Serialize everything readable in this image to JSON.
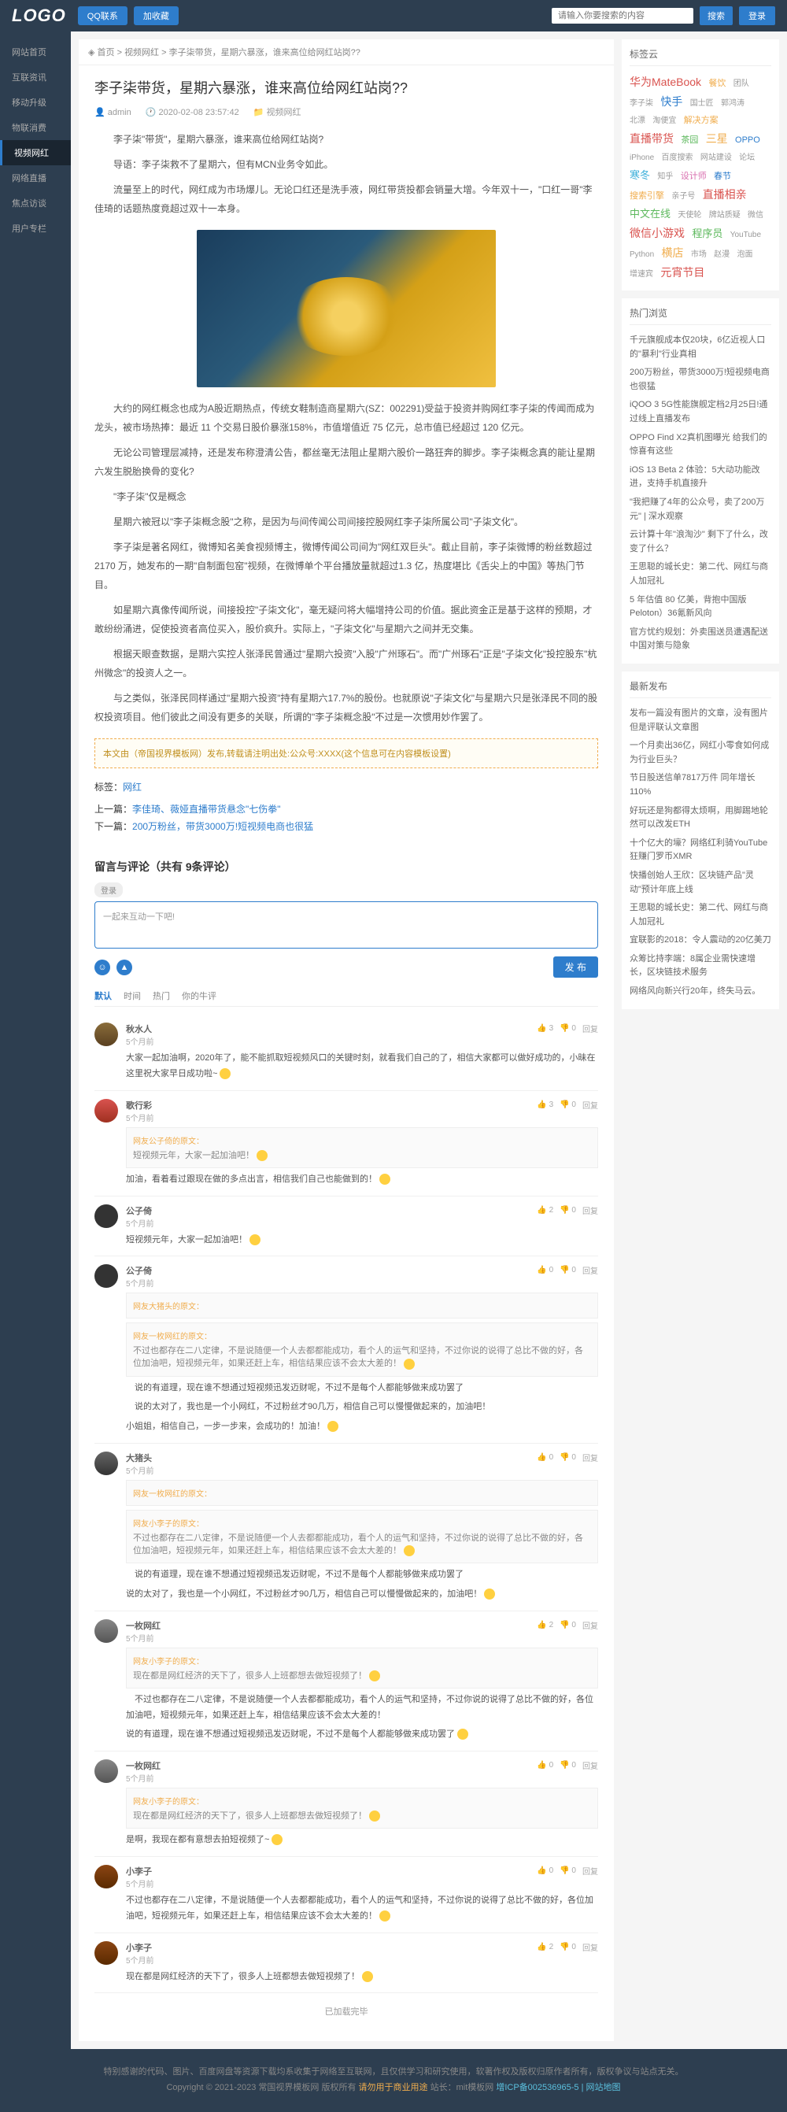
{
  "topbar": {
    "logo": "LOGO",
    "qq": "QQ联系",
    "fav": "加收藏",
    "search_placeholder": "请输入你要搜索的内容",
    "search_btn": "搜索",
    "login": "登录"
  },
  "nav": [
    {
      "label": "网站首页"
    },
    {
      "label": "互联资讯"
    },
    {
      "label": "移动升级"
    },
    {
      "label": "物联消费"
    },
    {
      "label": "视频网红",
      "active": true
    },
    {
      "label": "网络直播"
    },
    {
      "label": "焦点访谈"
    },
    {
      "label": "用户专栏"
    }
  ],
  "breadcrumb": {
    "home": "首页",
    "cat": "视频网红",
    "title": "李子柒带货，星期六暴涨，谁来高位给网红站岗??"
  },
  "article": {
    "title": "李子柒带货，星期六暴涨，谁来高位给网红站岗??",
    "author": "admin",
    "date": "2020-02-08 23:57:42",
    "cat": "视频网红",
    "p1": "李子柒\"带货\"，星期六暴涨，谁来高位给网红站岗?",
    "p2": "导语：李子柒救不了星期六，但有MCN业务令如此。",
    "p3": "流量至上的时代，网红成为市场爆儿。无论口红还是洗手液，网红带货投都会销量大增。今年双十一，\"口红一哥\"李佳琦的话题热度竟超过双十一本身。",
    "p4": "大约的网红概念也成为A股近期热点，传统女鞋制造商星期六(SZ：002291)受益于投资并购网红李子柒的传闻而成为龙头，被市场热捧：最近 11 个交易日股价暴涨158%，市值增值近 75 亿元，总市值已经超过 120 亿元。",
    "p5": "无论公司管理层减持，还是发布称澄清公告，都丝毫无法阻止星期六股价一路狂奔的脚步。李子柒概念真的能让星期六发生脱胎换骨的变化?",
    "p6": "\"李子柒\"仅是概念",
    "p7": "星期六被冠以\"李子柒概念股\"之称，是因为与间传闻公司间接控股网红李子柒所属公司\"子柒文化\"。",
    "p8": "李子柒是著名网红，微博知名美食视频博主，微博传闻公司间为\"网红双巨头\"。截止目前，李子柒微博的粉丝数超过 2170 万，她发布的一期\"自制面包窑\"视频，在微博单个平台播放量就超过1.3 亿，热度堪比《舌尖上的中国》等热门节目。",
    "p9": "如星期六真像传闻所说，间接投控\"子柒文化\"，毫无疑问将大幅增持公司的价值。据此资金正是基于这样的预期，才敢纷纷涌进，促使投资者高位买入，股价疯升。实际上，\"子柒文化\"与星期六之间并无交集。",
    "p10": "根据天眼查数据，是期六实控人张泽民曾通过\"星期六投资\"入股\"广州琢石\"。而\"广州琢石\"正是\"子柒文化\"投控股东\"杭州微念\"的投资人之一。",
    "p11": "与之类似，张泽民同样通过\"星期六投资\"持有星期六17.7%的股份。也就原说\"子柒文化\"与星期六只是张泽民不同的股权投资项目。他们彼此之间没有更多的关联，所谓的\"李子柒概念股\"不过是一次惯用妙作罢了。",
    "notice": "本文由（帝国视界模板网）发布,转载请注明出处:公众号:XXXX(这个信息可在内容模板设置)",
    "tags_label": "标签：",
    "tag_link": "网红",
    "prev_label": "上一篇：",
    "prev_link": "李佳琦、薇娅直播带货悬念\"七伤拳\"",
    "next_label": "下一篇：",
    "next_link": "200万粉丝，带货3000万!短视频电商也很猛"
  },
  "comments": {
    "title": "留言与评论（共有 9条评论）",
    "login_hint": "登录",
    "placeholder": "一起来互动一下吧!",
    "publish": "发 布",
    "tabs": [
      "默认",
      "时间",
      "热门",
      "你的牛评"
    ],
    "load_done": "已加载完毕",
    "list": [
      {
        "avatar": "c1",
        "user": "秋水人",
        "time": "5个月前",
        "like": "3",
        "dis": "0",
        "reply": "回复",
        "text": "大家一起加油啊，2020年了，能不能抓取短视频风口的关键时刻，就看我们自己的了，相信大家都可以做好成功的，小昧在这里祝大家早日成功啦~"
      },
      {
        "avatar": "c2",
        "user": "歌行彩",
        "time": "5个月前",
        "like": "3",
        "dis": "0",
        "reply": "回复",
        "quotes": [
          {
            "u": "公子倚",
            "t": "短视频元年，大家一起加油吧！"
          }
        ],
        "text": "加油，看着看过跟现在做的多点出言，相信我们自己也能做到的！"
      },
      {
        "avatar": "c3",
        "user": "公子倚",
        "time": "5个月前",
        "like": "2",
        "dis": "0",
        "reply": "回复",
        "text": "短视频元年，大家一起加油吧！"
      },
      {
        "avatar": "c3",
        "user": "公子倚",
        "time": "5个月前",
        "like": "0",
        "dis": "0",
        "reply": "回复",
        "quotes": [
          {
            "u": "大猪头",
            "t": ""
          },
          {
            "u": "一枚网红",
            "t": "不过也都存在二八定律，不是说随便一个人去都都能成功，看个人的运气和坚持，不过你说的说得了总比不做的好，各位加油吧，短视频元年，如果还赶上车，相信结果应该不会太大差的！"
          }
        ],
        "text2": "说的有道理，现在谁不想通过短视频迅发迈财呢，不过不是每个人都能够做来成功罢了",
        "text3": "说的太对了，我也是一个小网红，不过粉丝才90几万，相信自己可以慢慢做起来的，加油吧！",
        "text": "小姐姐，相信自己，一步一步来，会成功的！加油！"
      },
      {
        "avatar": "c4",
        "user": "大猪头",
        "time": "5个月前",
        "like": "0",
        "dis": "0",
        "reply": "回复",
        "quotes": [
          {
            "u": "一枚网红",
            "t": ""
          },
          {
            "u": "小李子",
            "t": "不过也都存在二八定律，不是说随便一个人去都都能成功，看个人的运气和坚持，不过你说的说得了总比不做的好，各位加油吧，短视频元年，如果还赶上车，相信结果应该不会太大差的！"
          }
        ],
        "text2": "说的有道理，现在谁不想通过短视频迅发迈财呢，不过不是每个人都能够做来成功罢了",
        "text": "说的太对了，我也是一个小网红，不过粉丝才90几万，相信自己可以慢慢做起来的，加油吧！"
      },
      {
        "avatar": "c5",
        "user": "一枚网红",
        "time": "5个月前",
        "like": "2",
        "dis": "0",
        "reply": "回复",
        "quotes": [
          {
            "u": "小李子",
            "t": "现在都是网红经济的天下了，很多人上班都想去做短视频了！"
          }
        ],
        "text2": "不过也都存在二八定律，不是说随便一个人去都都能成功，看个人的运气和坚持，不过你说的说得了总比不做的好，各位加油吧，短视频元年，如果还赶上车，相信结果应该不会太大差的！",
        "text": "说的有道理，现在谁不想通过短视频迅发迈财呢，不过不是每个人都能够做来成功罢了"
      },
      {
        "avatar": "c5",
        "user": "一枚网红",
        "time": "5个月前",
        "like": "0",
        "dis": "0",
        "reply": "回复",
        "quotes": [
          {
            "u": "小李子",
            "t": "现在都是网红经济的天下了，很多人上班都想去做短视频了！"
          }
        ],
        "text": "是啊，我现在都有意想去拍短视频了~"
      },
      {
        "avatar": "c6",
        "user": "小李子",
        "time": "5个月前",
        "like": "0",
        "dis": "0",
        "reply": "回复",
        "text": "不过也都存在二八定律，不是说随便一个人去都都能成功，看个人的运气和坚持，不过你说的说得了总比不做的好，各位加油吧，短视频元年，如果还赶上车，相信结果应该不会太大差的！"
      },
      {
        "avatar": "c6",
        "user": "小李子",
        "time": "5个月前",
        "like": "2",
        "dis": "0",
        "reply": "回复",
        "text": "现在都是网红经济的天下了，很多人上班都想去做短视频了！"
      }
    ]
  },
  "side": {
    "tagcloud_title": "标签云",
    "hot_title": "热门浏览",
    "hot": [
      "千元旗舰成本仅20块，6亿近视人口的\"暴利\"行业真相",
      "200万粉丝，带货3000万!短视频电商也很猛",
      "iQOO 3 5G性能旗舰定档2月25日!通过线上直播发布",
      "OPPO Find X2真机图曝光 给我们的惊喜有这些",
      "iOS 13 Beta 2 体验：5大动功能改进，支持手机直接升",
      "\"我把赚了4年的公众号，卖了200万元\" | 深水观察",
      "云计算十年\"浪淘沙\" 剩下了什么，改变了什么？",
      "王思聪的城长史：第二代、网红与商人加冠礼",
      "5 年估值 80 亿美，背抱中国版 Peloton）36氪新风向",
      "官方忧约规划：外卖围送员遭遇配送中国对策与隐象"
    ],
    "latest_title": "最新发布",
    "latest": [
      "发布一篇没有图片的文章，没有图片但是评联认文章图",
      "一个月卖出36亿，网红小零食如何成为行业巨头？",
      "节日股送信单7817万件 同年增长110%",
      "好玩还是狗都得太烦啊，用脚踢地轮然可以改发ETH",
      "十个亿大的壕？网络红利骑YouTube狂赚门罗币XMR",
      "快播创始人王欣：区块链产品\"灵动\"预计年底上线",
      "王思聪的城长史：第二代、网红与商人加冠礼",
      "宜联影的2018：令人震动的20亿美刀",
      "众筹比持李端：8属企业需快速增长，区块链技术服务",
      "网络风向新兴行20年，终失马云。"
    ]
  },
  "footer": {
    "l1": "特别感谢的代码、图片、百度网盘等资源下载均系收集于网络至互联网，且仅供学习和研究使用，软著作权及版权归原作者所有，版权争议与站点无关。",
    "l2_a": "Copyright © 2021-2023 常国视界模板网 版权所有",
    "l2_b": "请勿用于商业用途",
    "l2_c": " 站长：mit模板网",
    "l2_d": "增ICP备002536965-5",
    "l2_e": " | 网站地图"
  }
}
